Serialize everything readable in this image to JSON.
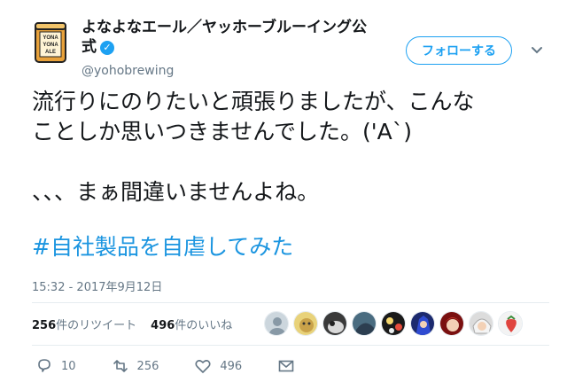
{
  "account": {
    "name_line1": "よなよなエール／ヤッホーブルーイング公",
    "name_line2": "式",
    "handle": "@yohobrewing",
    "avatar_label": "YONA YONA ALE",
    "verified_icon": "verified-badge-icon"
  },
  "follow_button": {
    "label": "フォローする",
    "color": "#1da1f2"
  },
  "menu": {
    "icon": "chevron-down-icon"
  },
  "tweet": {
    "line1": "流行りにのりたいと頑張りましたが、こんな",
    "line2": "ことしか思いつきませんでした。('A`)",
    "line3": "、、、まぁ間違いませんよね。",
    "hashtag": "#自社製品を自虐してみた",
    "hashtag_color": "#1b95e0"
  },
  "timestamp": "15:32 - 2017年9月12日",
  "stats": {
    "retweets_count": "256",
    "retweets_label": "件のリツイート",
    "likes_count": "496",
    "likes_label": "件のいいね"
  },
  "liker_avatars": [
    "default",
    "cartoon",
    "cat",
    "bird",
    "flowers",
    "anime-blue",
    "anime-red",
    "white-hair",
    "strawberry"
  ],
  "actions": {
    "reply": {
      "icon": "reply-icon",
      "count": "10"
    },
    "retweet": {
      "icon": "retweet-icon",
      "count": "256"
    },
    "like": {
      "icon": "heart-icon",
      "count": "496"
    },
    "dm": {
      "icon": "envelope-icon"
    }
  }
}
